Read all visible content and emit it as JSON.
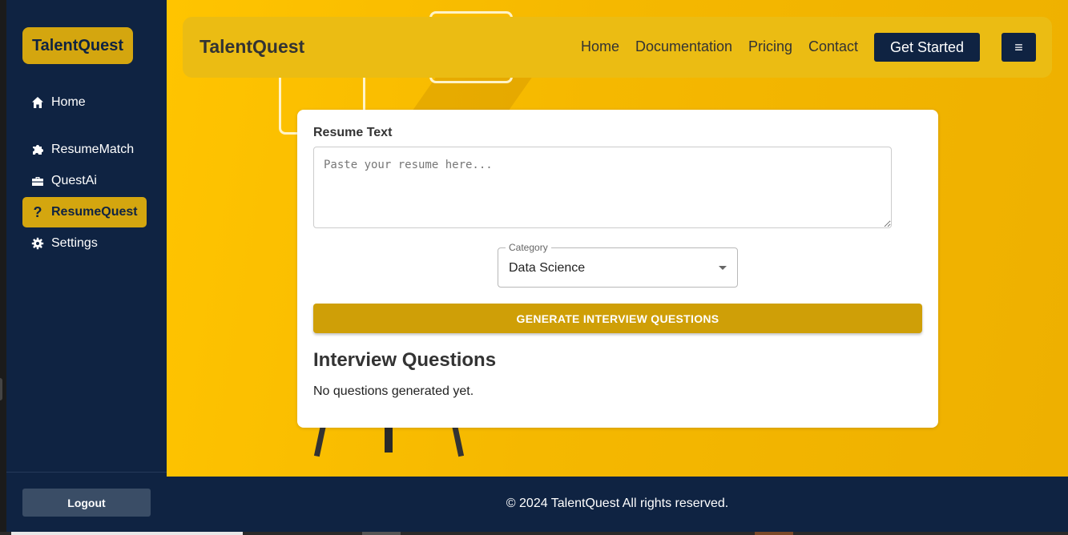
{
  "sidebar": {
    "brand": "TalentQuest",
    "items": [
      {
        "label": "Home",
        "icon": "home-icon"
      },
      {
        "label": "ResumeMatch",
        "icon": "puzzle-icon"
      },
      {
        "label": "QuestAi",
        "icon": "briefcase-icon"
      },
      {
        "label": "ResumeQuest",
        "icon": "question-icon",
        "active": true
      },
      {
        "label": "Settings",
        "icon": "gear-icon"
      }
    ],
    "logout_label": "Logout"
  },
  "header": {
    "title": "TalentQuest",
    "links": [
      "Home",
      "Documentation",
      "Pricing",
      "Contact"
    ],
    "cta_label": "Get Started",
    "menu_glyph": "≡"
  },
  "form": {
    "resume_label": "Resume Text",
    "resume_placeholder": "Paste your resume here...",
    "resume_value": "",
    "category_label": "Category",
    "category_value": "Data Science",
    "generate_label": "GENERATE INTERVIEW QUESTIONS"
  },
  "results": {
    "heading": "Interview Questions",
    "empty_text": "No questions generated yet."
  },
  "footer": {
    "text": "© 2024 TalentQuest All rights reserved."
  },
  "colors": {
    "sidebar_bg": "#0f2342",
    "accent": "#d4a60f",
    "main_bg": "#f5b800",
    "button_gold": "#cf9f07"
  }
}
